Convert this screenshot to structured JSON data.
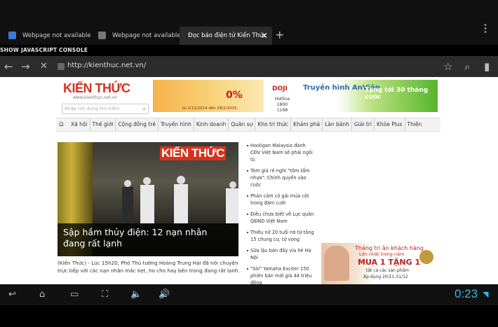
{
  "tabs": [
    {
      "label": "Webpage not available",
      "favicon_color": "#3a7bd5"
    },
    {
      "label": "Webpage not available",
      "favicon_color": "#777777"
    },
    {
      "label": "Đọc báo điện tử Kiến Thức",
      "active": true
    }
  ],
  "js_console_label": "SHOW JAVASCRIPT CONSOLE",
  "urlbar": {
    "url": "http://kienthuc.net.vn/"
  },
  "site": {
    "logo": "KIẾN THỨC",
    "logo_sub": "www.kienthuc.net.vn",
    "search_placeholder": "Nhập nội dung tìm kiếm",
    "nav": [
      "Xã hội",
      "Thế giới",
      "Cộng đồng trẻ",
      "Truyền hình",
      "Kinh doanh",
      "Quân sự",
      "Kho tri thức",
      "Khám phá",
      "Làn bánh",
      "Giải trí",
      "Khỏe Plus",
      "Thiền"
    ],
    "hero": {
      "brand": "KIẾN THỨC",
      "title": "Sập hầm thủy điện: 12 nạn nhân đang rất lạnh",
      "lead": "(Kiến Thức) - Lúc 15h20, Phó Thủ tướng Hoàng Trung Hải đã nói chuyện trực tiếp với các nạn nhân mắc kẹt, ho cho hay bên trong đang rất lạnh."
    },
    "news": [
      "Hooligan Malaysia đánh CĐV Việt Nam sẽ phải ngồi tù",
      "Tòm giá rẻ nghi \"tôm tẩm nhựa\": Chính quyền vào cuộc",
      "Phản cảm cô gái múa cột trong đám cưới",
      "Điều chưa biết về Lực quân QĐND Việt Nam",
      "Thiếu nữ 20 tuổi rơi từ tầng 15 chung cư, tử vong",
      "Sữa lậu bán đầy vỉa hè Hà Nội",
      "\"Sói\" Yamaha Exciter 150 phiên bản mới giá 44 triệu đồng"
    ],
    "ads": {
      "ad1_zero": "0%",
      "ad1_text": "từ 1/12/2014 đến 28/2/2015",
      "doji": "DOJI",
      "hotline": "Hotline 1800 1168",
      "anvien": "Truyền hình AnViên",
      "anvien_gift": "Tặng tới 30 tháng cước",
      "promo1": "Tháng tri ân khách hàng",
      "promo2": "Lớn nhất trong năm",
      "promo3": "MUA 1 TẶNG 1",
      "promo4": "tất cả các sản phẩm",
      "promo5": "Áp dụng 20/11-31/12"
    }
  },
  "status": {
    "time": "0:23"
  },
  "colors": {
    "accent": "#37b6e3",
    "brand_red": "#d6321f"
  }
}
